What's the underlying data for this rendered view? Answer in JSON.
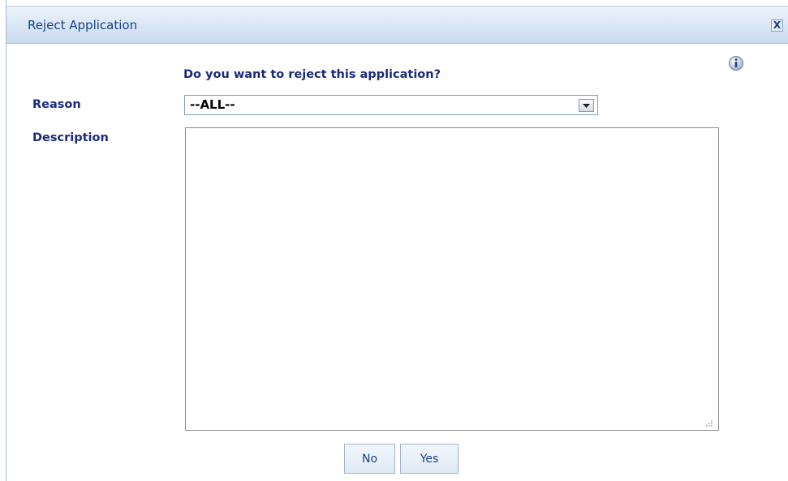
{
  "dialog": {
    "title": "Reject Application",
    "close_glyph": "X",
    "info_icon": "info-icon",
    "prompt": "Do you want to reject this application?",
    "reason": {
      "label": "Reason",
      "selected": "--ALL--"
    },
    "description": {
      "label": "Description",
      "value": ""
    },
    "buttons": {
      "no": "No",
      "yes": "Yes"
    }
  },
  "colors": {
    "label_text": "#1b2b7a",
    "title_text": "#15428b",
    "titlebar_bg": "#d9e6f4"
  }
}
